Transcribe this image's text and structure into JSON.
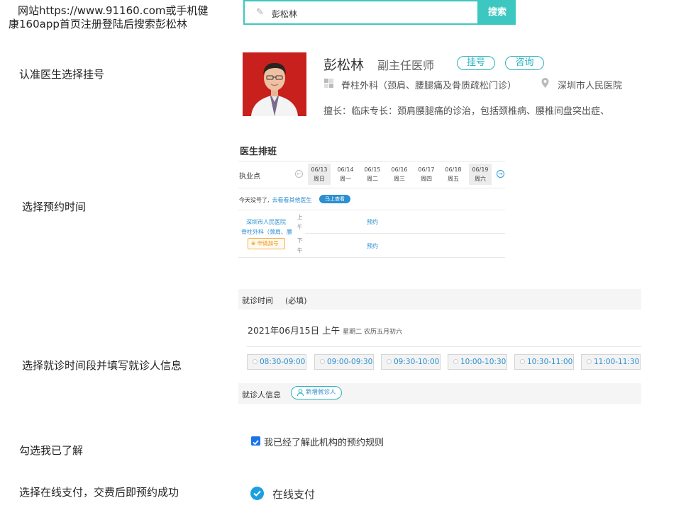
{
  "steps": {
    "step1_line1": "网站https://www.91160.com或手机健",
    "step1_line2": "康160app首页注册登陆后搜索彭松林",
    "step2": "认准医生选择挂号",
    "step3": "选择预约时间",
    "step4": "选择就诊时间段并填写就诊人信息",
    "step5": "勾选我已了解",
    "step6": "选择在线支付，交费后即预约成功"
  },
  "search": {
    "value": "彭松林",
    "button": "搜索",
    "icon": "pencil-icon"
  },
  "doctor": {
    "name": "彭松林",
    "title": "副主任医师",
    "register_button": "挂号",
    "consult_button": "咨询",
    "department": "脊柱外科（颈肩、腰腿痛及骨质疏松门诊）",
    "hospital": "深圳市人民医院",
    "specialty": "擅长：临床专长：颈肩腰腿痛的诊治，包括颈椎病、腰椎间盘突出症、"
  },
  "schedule": {
    "title": "医生排班",
    "column_header": "执业点",
    "days": [
      {
        "date": "06/13",
        "weekday": "周日",
        "selected": true
      },
      {
        "date": "06/14",
        "weekday": "周一",
        "selected": false
      },
      {
        "date": "06/15",
        "weekday": "周二",
        "selected": false
      },
      {
        "date": "06/16",
        "weekday": "周三",
        "selected": false
      },
      {
        "date": "06/17",
        "weekday": "周四",
        "selected": false
      },
      {
        "date": "06/18",
        "weekday": "周五",
        "selected": false
      },
      {
        "date": "06/19",
        "weekday": "周六",
        "selected": true
      }
    ],
    "notice": "今天没号了,",
    "notice_link": "去看看其他医生",
    "notice_button": "马上查看",
    "hospital_link": "深圳市人民医院",
    "dept_link": "脊柱外科（颈肩、腰",
    "add_button": "申请加号",
    "morning": "上午",
    "afternoon": "下午",
    "book_morning": "预约",
    "book_afternoon": "预约"
  },
  "visit": {
    "header": "就诊时间",
    "required": "(必填)",
    "date": "2021年06月15日 上午",
    "date_sub": "星期二 农历五月初六",
    "slots": [
      "08:30-09:00",
      "09:00-09:30",
      "09:30-10:00",
      "10:00-10:30",
      "10:30-11:00",
      "11:00-11:30"
    ],
    "patient_header": "就诊人信息",
    "new_patient_button": "新增就诊人"
  },
  "agree": {
    "text": "我已经了解此机构的预约规则",
    "checked": true
  },
  "payment": {
    "label": "在线支付",
    "selected": true
  },
  "colors": {
    "teal": "#3cc8c0",
    "link_blue": "#2b8fd0",
    "orange": "#f08a00"
  }
}
